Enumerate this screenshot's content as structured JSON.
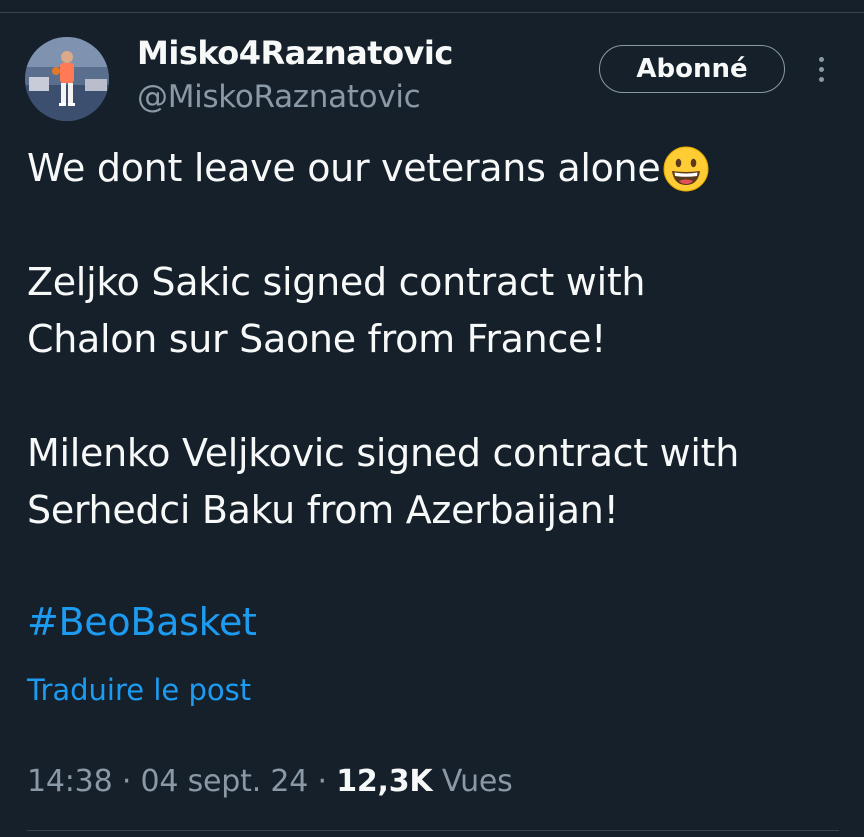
{
  "author": {
    "display_name": "Misko4Raznatovic",
    "handle": "@MiskoRaznatovic",
    "avatar_icon": "avatar-photo"
  },
  "header": {
    "follow_label": "Abonné",
    "more_icon": "more-vertical-icon"
  },
  "tweet": {
    "lines": [
      "We dont leave our veterans alone",
      "Zeljko Sakic signed contract with",
      "Chalon sur Saone from France!",
      "Milenko Veljkovic signed contract with",
      "Serhedci Baku from Azerbaijan!"
    ],
    "emoji": "grinning-face-emoji",
    "hashtag": "#BeoBasket",
    "translate_label": "Traduire le post"
  },
  "meta": {
    "time": "14:38",
    "separator": "·",
    "date": "04 sept. 24",
    "views_count": "12,3K",
    "views_label": "Vues"
  },
  "colors": {
    "background": "#15202b",
    "text": "#f7f9f9",
    "secondary": "#8b98a5",
    "accent": "#1d9bf0"
  }
}
